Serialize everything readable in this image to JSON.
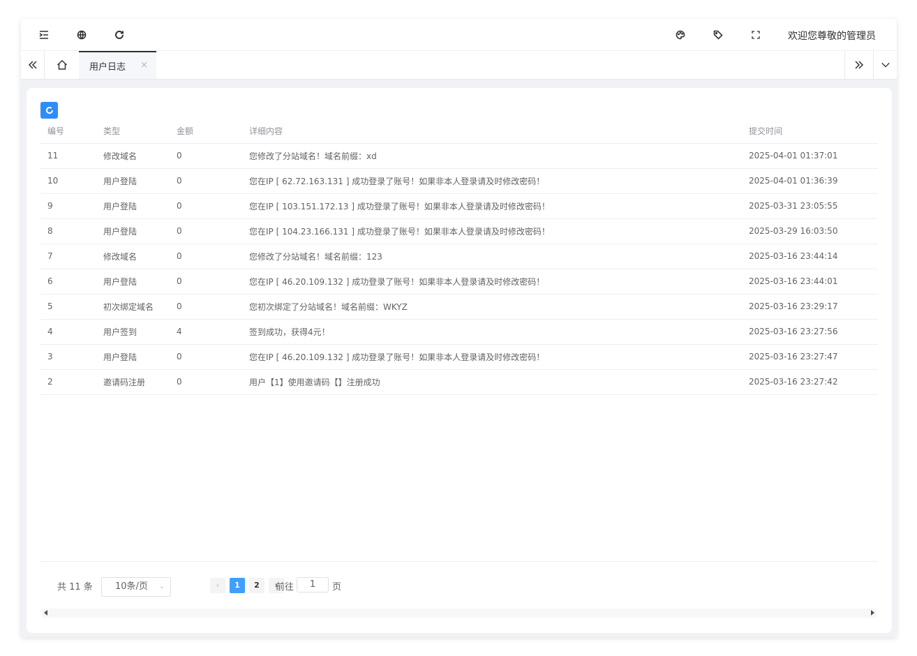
{
  "header": {
    "welcome": "欢迎您尊敬的管理员",
    "left_icons": [
      "menu-fold-icon",
      "globe-icon",
      "refresh-icon"
    ],
    "right_icons": [
      "palette-icon",
      "tag-icon",
      "fullscreen-icon"
    ]
  },
  "tabs": {
    "items": [
      {
        "label": "用户日志",
        "active": true
      }
    ],
    "close_glyph": "×"
  },
  "table": {
    "headers": [
      "编号",
      "类型",
      "金额",
      "详细内容",
      "提交时间"
    ],
    "rows": [
      [
        "11",
        "修改域名",
        "0",
        "您修改了分站域名！域名前缀：xd",
        "2025-04-01 01:37:01"
      ],
      [
        "10",
        "用户登陆",
        "0",
        "您在IP [ 62.72.163.131 ] 成功登录了账号！如果非本人登录请及时修改密码！",
        "2025-04-01 01:36:39"
      ],
      [
        "9",
        "用户登陆",
        "0",
        "您在IP [ 103.151.172.13 ] 成功登录了账号！如果非本人登录请及时修改密码！",
        "2025-03-31 23:05:55"
      ],
      [
        "8",
        "用户登陆",
        "0",
        "您在IP [ 104.23.166.131 ] 成功登录了账号！如果非本人登录请及时修改密码！",
        "2025-03-29 16:03:50"
      ],
      [
        "7",
        "修改域名",
        "0",
        "您修改了分站域名！域名前缀：123",
        "2025-03-16 23:44:14"
      ],
      [
        "6",
        "用户登陆",
        "0",
        "您在IP [ 46.20.109.132 ] 成功登录了账号！如果非本人登录请及时修改密码！",
        "2025-03-16 23:44:01"
      ],
      [
        "5",
        "初次绑定域名",
        "0",
        "您初次绑定了分站域名！域名前缀：WKYZ",
        "2025-03-16 23:29:17"
      ],
      [
        "4",
        "用户签到",
        "4",
        "签到成功，获得4元！",
        "2025-03-16 23:27:56"
      ],
      [
        "3",
        "用户登陆",
        "0",
        "您在IP [ 46.20.109.132 ] 成功登录了账号！如果非本人登录请及时修改密码！",
        "2025-03-16 23:27:47"
      ],
      [
        "2",
        "邀请码注册",
        "0",
        "用户【1】使用邀请码【】注册成功",
        "2025-03-16 23:27:42"
      ]
    ]
  },
  "pagination": {
    "total_text": "共 11 条",
    "page_size": "10条/页",
    "prev": "‹",
    "next": "›",
    "pages": [
      "1",
      "2"
    ],
    "current_page": "1",
    "goto_prefix": "前往",
    "goto_value": "1",
    "goto_suffix": "页"
  },
  "colors": {
    "primary": "#409eff",
    "refresh_button": "#2e8ef7"
  }
}
